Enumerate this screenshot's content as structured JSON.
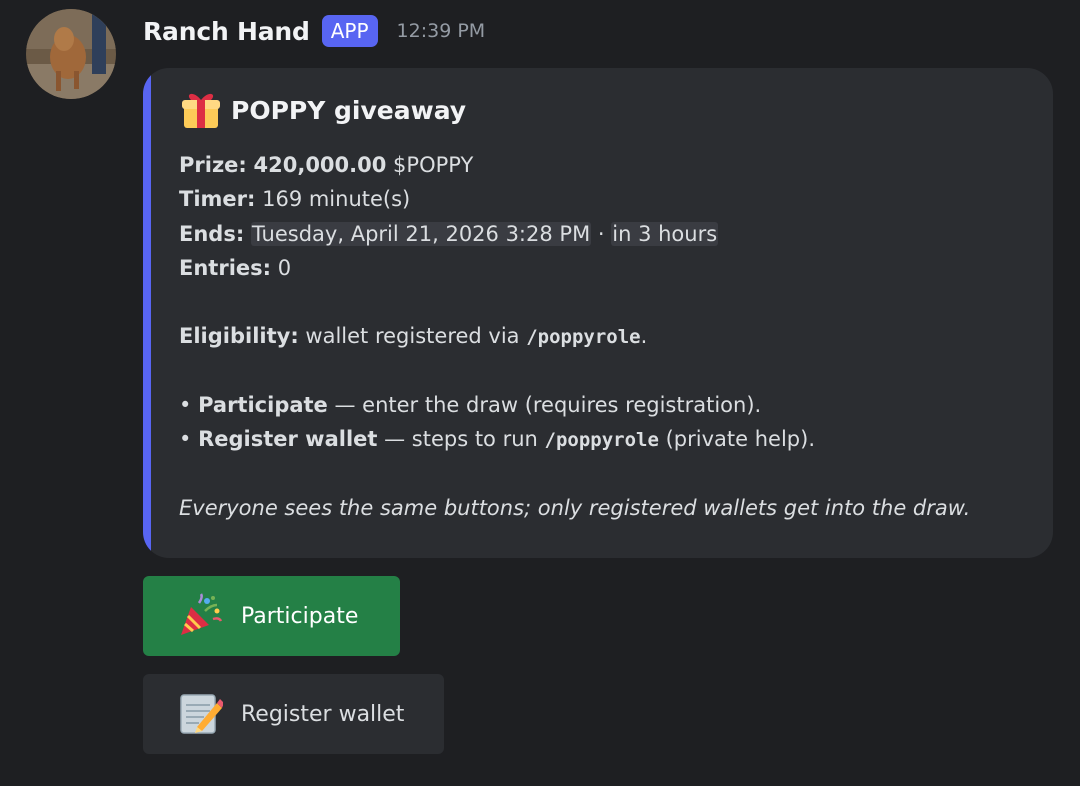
{
  "message": {
    "author": "Ranch Hand",
    "badge": "APP",
    "timestamp": "12:39 PM"
  },
  "embed": {
    "accent_color": "#5865f2",
    "title_icon": "gift-icon",
    "title": "POPPY giveaway",
    "prize_label": "Prize:",
    "prize_amount": "420,000.00",
    "prize_token": "$POPPY",
    "timer_label": "Timer:",
    "timer_value": "169 minute(s)",
    "ends_label": "Ends:",
    "ends_date": "Tuesday, April 21, 2026 3:28 PM",
    "ends_sep": "·",
    "ends_relative": "in 3 hours",
    "entries_label": "Entries:",
    "entries_value": "0",
    "eligibility_label": "Eligibility:",
    "eligibility_text": "wallet registered via",
    "eligibility_command": "/poppyrole",
    "eligibility_end": ".",
    "bullet1_dot": "•",
    "bullet1_label": "Participate",
    "bullet1_text": "— enter the draw (requires registration).",
    "bullet2_dot": "•",
    "bullet2_label": "Register wallet",
    "bullet2_text": "— steps to run",
    "bullet2_command": "/poppyrole",
    "bullet2_end": "(private help).",
    "footer_note": "Everyone sees the same buttons; only registered wallets get into the draw."
  },
  "buttons": {
    "participate": {
      "icon": "party-popper-icon",
      "label": "Participate",
      "color": "#248046"
    },
    "register": {
      "icon": "memo-icon",
      "label": "Register wallet",
      "color": "#2b2d31"
    }
  }
}
